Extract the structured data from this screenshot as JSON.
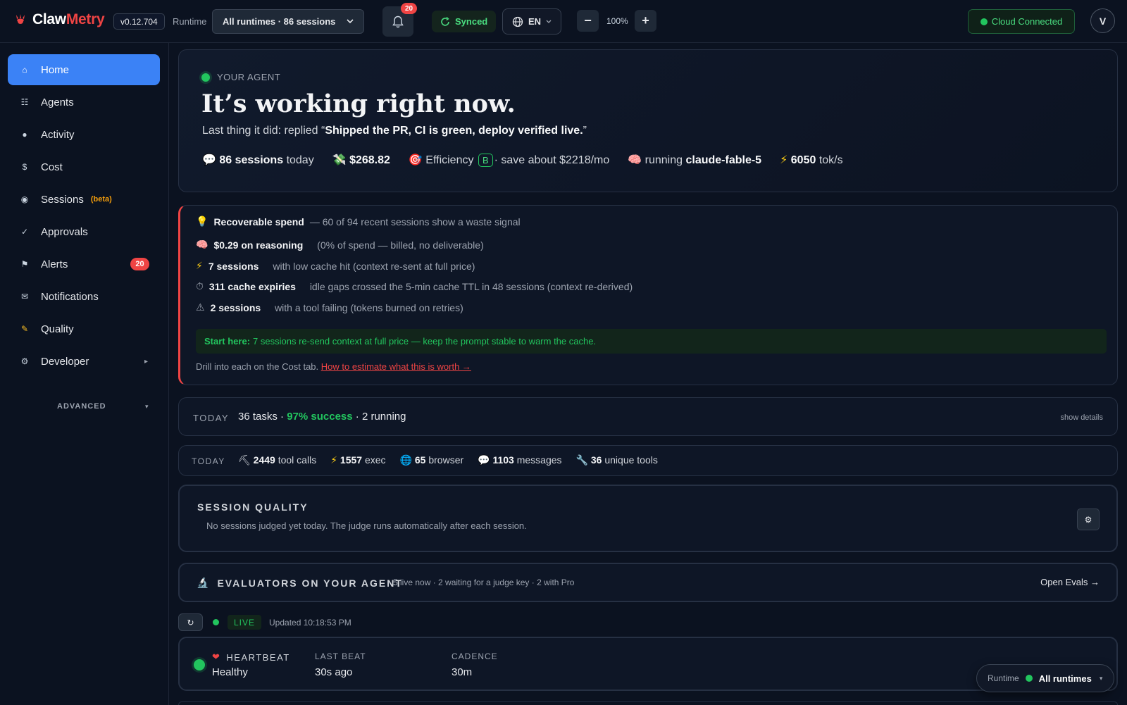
{
  "header": {
    "brand_first": "Claw",
    "brand_second": "Metry",
    "version": "v0.12.704",
    "runtime_label": "Runtime",
    "runtime_select": "All runtimes · 86 sessions",
    "notification_count": "20",
    "sync_status": "Synced",
    "language": "EN",
    "zoom_level": "100%",
    "zoom_minus": "−",
    "zoom_plus": "+",
    "cloud_status": "Cloud Connected",
    "avatar_initial": "V",
    "accent_color": "#3b82f6",
    "success_color": "#22c55e",
    "alert_color": "#ef4444"
  },
  "sidebar": {
    "items": [
      {
        "label": "Home",
        "icon": "home-icon"
      },
      {
        "label": "Agents",
        "icon": "grid-icon"
      },
      {
        "label": "Activity",
        "icon": "circle-icon"
      },
      {
        "label": "Cost",
        "icon": "dollar-icon"
      },
      {
        "label": "Sessions",
        "icon": "session-icon",
        "tag": "(beta)"
      },
      {
        "label": "Approvals",
        "icon": "check-icon"
      },
      {
        "label": "Alerts",
        "icon": "flag-icon",
        "badge": "20"
      },
      {
        "label": "Notifications",
        "icon": "mail-icon"
      },
      {
        "label": "Quality",
        "icon": "memo-icon"
      },
      {
        "label": "Developer",
        "icon": "gear-icon"
      }
    ],
    "advanced_label": "ADVANCED"
  },
  "hero": {
    "tag": "YOUR AGENT",
    "title": "It’s working right now.",
    "last_prefix": "Last thing it did: replied “",
    "last_quote": "Shipped the PR, CI is green, deploy verified live.",
    "last_suffix": "”",
    "sessions_value": "86 sessions",
    "sessions_suffix": "today",
    "cost_value": "$268.82",
    "efficiency_label": "Efficiency",
    "efficiency_grade": "B",
    "efficiency_suffix": "· save about $2218/mo",
    "running_prefix": "running",
    "running_model": "claude-fable-5",
    "throughput_value": "6050",
    "throughput_unit": "tok/s"
  },
  "waste": {
    "title": "Recoverable spend",
    "summary": "— 60 of 94 recent sessions show a waste signal",
    "rows": [
      {
        "value": "$0.29 on reasoning",
        "text": "(0% of spend — billed, no deliverable)"
      },
      {
        "value": "7 sessions",
        "text": "with low cache hit (context re-sent at full price)"
      },
      {
        "value": "311 cache expiries",
        "text": "idle gaps crossed the 5-min cache TTL in 48 sessions (context re-derived)"
      },
      {
        "value": "2 sessions",
        "text": "with a tool failing (tokens burned on retries)"
      }
    ],
    "start_label": "Start here:",
    "start_text": "7 sessions re-send context at full price — keep the prompt stable to warm the cache.",
    "drill_text": "Drill into each on the Cost tab.",
    "drill_link": "How to estimate what this is worth →"
  },
  "today_tasks": {
    "label": "TODAY",
    "tasks": "36 tasks ·",
    "success": "97% success",
    "running": "· 2 running",
    "details": "show details"
  },
  "today_tools": {
    "label": "TODAY",
    "stats": [
      {
        "value": "2449",
        "text": "tool calls"
      },
      {
        "value": "1557",
        "text": "exec"
      },
      {
        "value": "65",
        "text": "browser"
      },
      {
        "value": "1103",
        "text": "messages"
      },
      {
        "value": "36",
        "text": "unique tools"
      }
    ]
  },
  "session_quality": {
    "title": "SESSION QUALITY",
    "desc": "No sessions judged yet today. The judge runs automatically after each session."
  },
  "evaluators": {
    "title": "EVALUATORS ON YOUR AGENT",
    "desc": "5 live now · 2 waiting for a judge key · 2 with Pro",
    "open": "Open Evals →"
  },
  "live": {
    "label": "LIVE",
    "updated": "Updated 10:18:53 PM"
  },
  "heartbeat": {
    "title": "HEARTBEAT",
    "status": "Healthy",
    "last_beat_label": "LAST BEAT",
    "last_beat_value": "30s ago",
    "cadence_label": "CADENCE",
    "cadence_value": "30m"
  },
  "runtime_pill": {
    "label": "Runtime",
    "value": "All runtimes"
  }
}
